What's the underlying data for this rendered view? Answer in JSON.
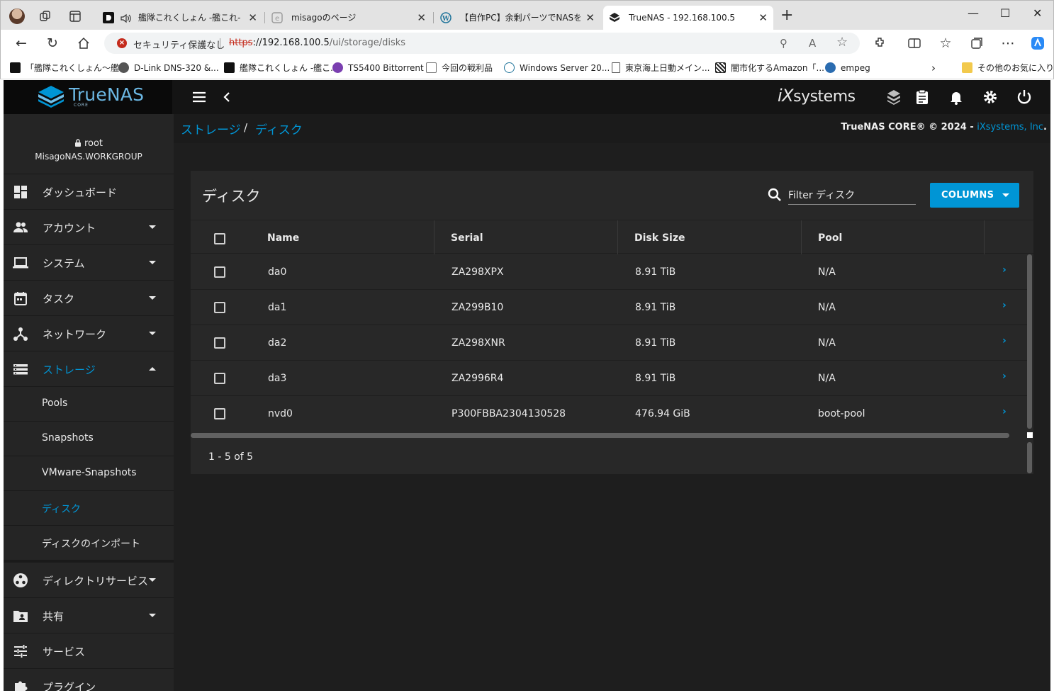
{
  "browser": {
    "tabs": [
      {
        "label": "艦隊これくしょん -艦これ- - オン",
        "active": false
      },
      {
        "label": "misagoのページ",
        "active": false
      },
      {
        "label": "【自作PC】余剰パーツでNASを組み立",
        "active": false
      },
      {
        "label": "TrueNAS - 192.168.100.5",
        "active": true
      }
    ],
    "security_text": "セキュリティ保護なし",
    "url_scheme": "https",
    "url_host": "://192.168.100.5",
    "url_path": "/ui/storage/disks",
    "bookmarks": [
      "「艦隊これくしょん～艦...",
      "D-Link DNS-320 &...",
      "艦隊これくしょん -艦こ...",
      "TS5400 Bittorrent",
      "今回の戦利品",
      "Windows Server 20...",
      "東京海上日動メイン...",
      "闇市化するAmazon「...",
      "empeg"
    ],
    "other_favorites": "その他のお気に入り"
  },
  "app": {
    "logo_text": "TrueNAS",
    "logo_sub": "CORE",
    "brand_ix": "iX",
    "brand_systems": "systems",
    "user": {
      "name": "root",
      "host": "MisagoNAS.WORKGROUP"
    },
    "menu": {
      "dashboard": "ダッシュボード",
      "accounts": "アカウント",
      "system": "システム",
      "tasks": "タスク",
      "network": "ネットワーク",
      "storage": "ストレージ",
      "directory": "ディレクトリサービス",
      "sharing": "共有",
      "services": "サービス",
      "plugins": "プラグイン"
    },
    "storage_sub": {
      "pools": "Pools",
      "snapshots": "Snapshots",
      "vmware": "VMware-Snapshots",
      "disks": "ディスク",
      "import": "ディスクのインポート"
    },
    "breadcrumb": {
      "parent": "ストレージ",
      "sep": "/",
      "current": "ディスク"
    },
    "copyright": {
      "text": "TrueNAS CORE® © 2024 - ",
      "link": "iXsystems, Inc",
      "end": "."
    },
    "colors": {
      "accent": "#0095d5",
      "bg": "#1e1e1e",
      "card": "#282828"
    }
  },
  "disks": {
    "title": "ディスク",
    "filter_placeholder": "Filter ディスク",
    "columns_button": "COLUMNS",
    "headers": {
      "name": "Name",
      "serial": "Serial",
      "size": "Disk Size",
      "pool": "Pool"
    },
    "rows": [
      {
        "name": "da0",
        "serial": "ZA298XPX",
        "size": "8.91 TiB",
        "pool": "N/A"
      },
      {
        "name": "da1",
        "serial": "ZA299B10",
        "size": "8.91 TiB",
        "pool": "N/A"
      },
      {
        "name": "da2",
        "serial": "ZA298XNR",
        "size": "8.91 TiB",
        "pool": "N/A"
      },
      {
        "name": "da3",
        "serial": "ZA2996R4",
        "size": "8.91 TiB",
        "pool": "N/A"
      },
      {
        "name": "nvd0",
        "serial": "P300FBBA2304130528",
        "size": "476.94 GiB",
        "pool": "boot-pool"
      }
    ],
    "pager": "1 - 5 of 5"
  }
}
